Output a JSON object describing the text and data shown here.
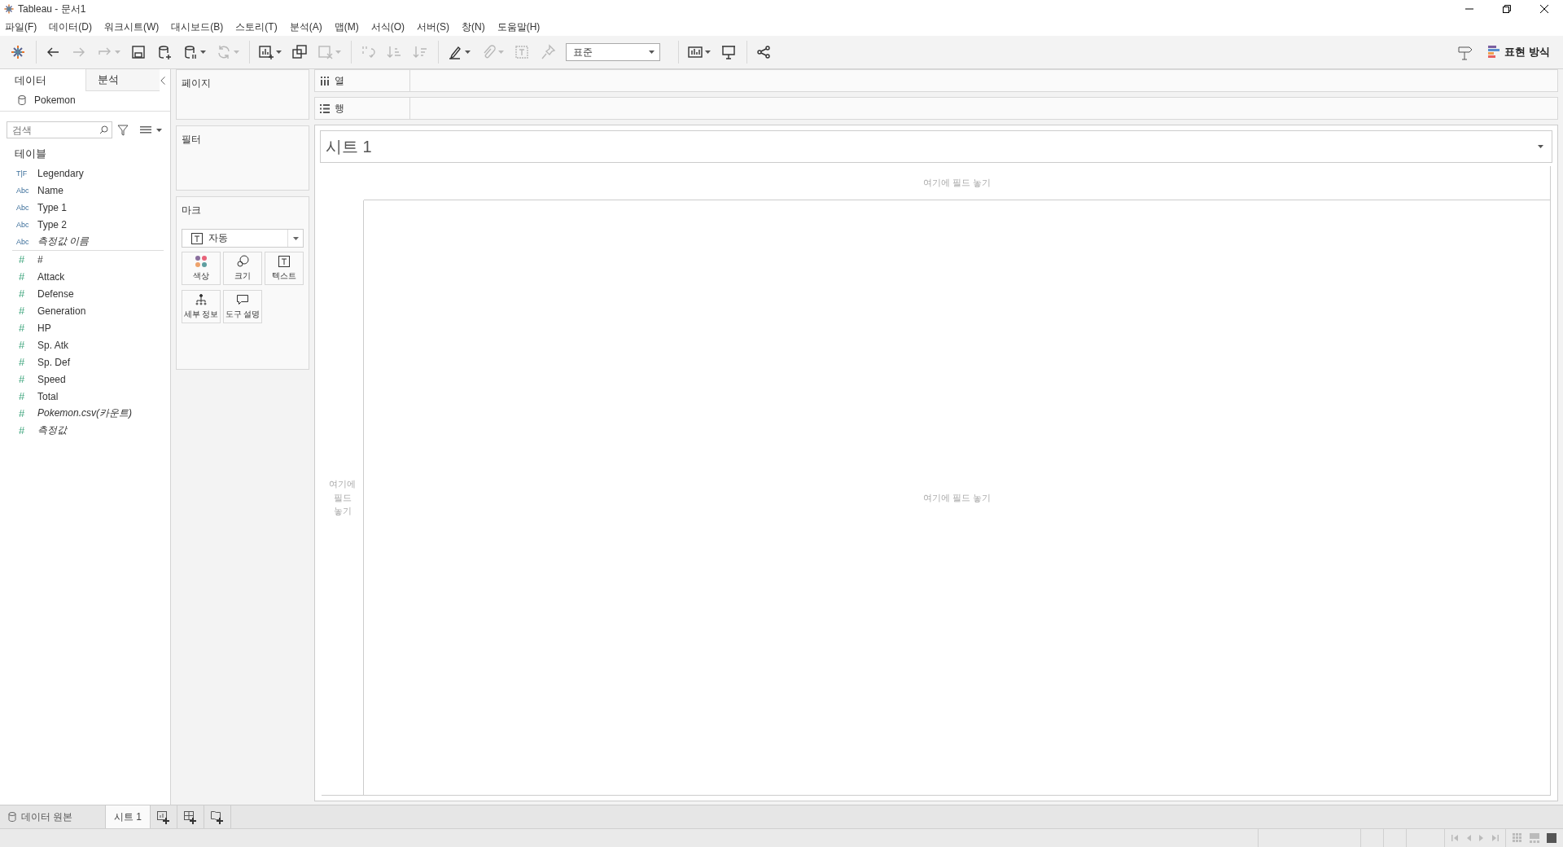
{
  "window": {
    "title": "Tableau - 문서1"
  },
  "menu": [
    "파일(F)",
    "데이터(D)",
    "워크시트(W)",
    "대시보드(B)",
    "스토리(T)",
    "분석(A)",
    "맵(M)",
    "서식(O)",
    "서버(S)",
    "창(N)",
    "도움말(H)"
  ],
  "toolbar": [
    {
      "kind": "logo"
    },
    {
      "kind": "sep"
    },
    {
      "kind": "back",
      "disabled": false,
      "caret": false
    },
    {
      "kind": "forward",
      "disabled": true,
      "caret": false
    },
    {
      "kind": "redo",
      "disabled": true,
      "caret": true
    },
    {
      "kind": "save",
      "disabled": false,
      "caret": false
    },
    {
      "kind": "new-datasource",
      "disabled": false,
      "caret": false
    },
    {
      "kind": "pause",
      "disabled": false,
      "caret": true
    },
    {
      "kind": "refresh",
      "disabled": true,
      "caret": true
    },
    {
      "kind": "sep"
    },
    {
      "kind": "new-sheet",
      "disabled": false,
      "caret": true
    },
    {
      "kind": "duplicate",
      "disabled": false,
      "caret": false
    },
    {
      "kind": "clear",
      "disabled": true,
      "caret": true
    },
    {
      "kind": "sep"
    },
    {
      "kind": "swap",
      "disabled": true,
      "caret": false
    },
    {
      "kind": "sort-asc",
      "disabled": true,
      "caret": false
    },
    {
      "kind": "sort-desc",
      "disabled": true,
      "caret": false
    },
    {
      "kind": "sep"
    },
    {
      "kind": "highlight",
      "disabled": false,
      "caret": true
    },
    {
      "kind": "clip",
      "disabled": true,
      "caret": true
    },
    {
      "kind": "label",
      "disabled": true,
      "caret": false
    },
    {
      "kind": "pin",
      "disabled": true,
      "caret": false
    },
    {
      "kind": "fit",
      "value": "표준"
    },
    {
      "kind": "sep"
    },
    {
      "kind": "show-me",
      "disabled": false,
      "caret": true
    },
    {
      "kind": "present",
      "disabled": false,
      "caret": false
    },
    {
      "kind": "sep"
    },
    {
      "kind": "share",
      "disabled": false,
      "caret": false
    }
  ],
  "show_me": {
    "label": "표현 방식"
  },
  "data_pane": {
    "tabs": [
      {
        "label": "데이터",
        "selected": true
      },
      {
        "label": "분석",
        "selected": false
      }
    ],
    "source": "Pokemon",
    "search": {
      "placeholder": "검색"
    },
    "section": "테이블",
    "fields": [
      {
        "type": "T|F",
        "kind": "dimension",
        "name": "Legendary",
        "generated": false
      },
      {
        "type": "Abc",
        "kind": "dimension",
        "name": "Name",
        "generated": false
      },
      {
        "type": "Abc",
        "kind": "dimension",
        "name": "Type 1",
        "generated": false
      },
      {
        "type": "Abc",
        "kind": "dimension",
        "name": "Type 2",
        "generated": false
      },
      {
        "type": "Abc",
        "kind": "dimension",
        "name": "측정값 이름",
        "generated": true
      },
      {
        "type": "#",
        "kind": "measure",
        "name": "#",
        "generated": false
      },
      {
        "type": "#",
        "kind": "measure",
        "name": "Attack",
        "generated": false
      },
      {
        "type": "#",
        "kind": "measure",
        "name": "Defense",
        "generated": false
      },
      {
        "type": "#",
        "kind": "measure",
        "name": "Generation",
        "generated": false
      },
      {
        "type": "#",
        "kind": "measure",
        "name": "HP",
        "generated": false
      },
      {
        "type": "#",
        "kind": "measure",
        "name": "Sp. Atk",
        "generated": false
      },
      {
        "type": "#",
        "kind": "measure",
        "name": "Sp. Def",
        "generated": false
      },
      {
        "type": "#",
        "kind": "measure",
        "name": "Speed",
        "generated": false
      },
      {
        "type": "#",
        "kind": "measure",
        "name": "Total",
        "generated": false
      },
      {
        "type": "#",
        "kind": "measure",
        "name": "Pokemon.csv(카운트)",
        "generated": true
      },
      {
        "type": "#",
        "kind": "measure",
        "name": "측정값",
        "generated": true
      }
    ]
  },
  "cards": {
    "pages": "페이지",
    "filters": "필터",
    "marks": {
      "title": "마크",
      "mark_type": "자동",
      "buttons": [
        {
          "kind": "color",
          "label": "색상"
        },
        {
          "kind": "size",
          "label": "크기"
        },
        {
          "kind": "text",
          "label": "텍스트"
        },
        {
          "kind": "detail",
          "label": "세부 정보"
        },
        {
          "kind": "tooltip",
          "label": "도구 설명"
        }
      ]
    }
  },
  "shelves": [
    {
      "kind": "columns",
      "label": "열"
    },
    {
      "kind": "rows",
      "label": "행"
    }
  ],
  "sheet": {
    "title": "시트 1",
    "drop_top": "여기에 필드 놓기",
    "drop_left": "여기에 필드 놓기",
    "drop_center": "여기에 필드 놓기"
  },
  "bottom_tabs": [
    {
      "kind": "datasource",
      "label": "데이터 원본",
      "selected": false
    },
    {
      "kind": "sheet",
      "label": "시트 1",
      "selected": true
    }
  ],
  "new_buttons": [
    {
      "kind": "new-worksheet"
    },
    {
      "kind": "new-dashboard"
    },
    {
      "kind": "new-story"
    }
  ],
  "view_buttons": [
    {
      "kind": "grid",
      "selected": false
    },
    {
      "kind": "filmstrip",
      "selected": false
    },
    {
      "kind": "tabs",
      "selected": true
    }
  ]
}
